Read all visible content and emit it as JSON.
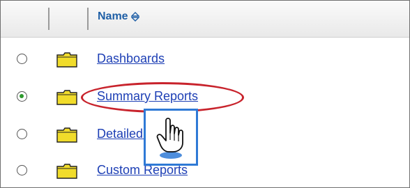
{
  "header": {
    "name_column": "Name"
  },
  "rows": [
    {
      "label": "Dashboards",
      "selected": false
    },
    {
      "label": "Summary Reports",
      "selected": true
    },
    {
      "label": "Detailed Reports",
      "selected": false
    },
    {
      "label": "Custom Reports",
      "selected": false
    }
  ],
  "icons": {
    "folder": "folder-icon",
    "sort": "sort-icon",
    "cursor": "hand-pointer-icon"
  },
  "colors": {
    "link": "#1d3fb5",
    "header_text": "#1f5fa6",
    "highlight": "#c8232c",
    "cursor_box": "#2f7ad6",
    "folder": "#f1dc2b"
  }
}
